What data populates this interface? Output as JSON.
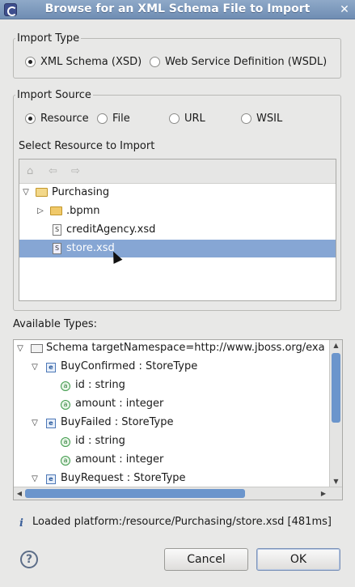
{
  "window": {
    "title": "Browse for an XML Schema File to Import",
    "close_glyph": "✕"
  },
  "import_type": {
    "legend": "Import Type",
    "options": [
      {
        "label": "XML Schema (XSD)",
        "selected": true
      },
      {
        "label": "Web Service Definition (WSDL)",
        "selected": false
      }
    ]
  },
  "import_source": {
    "legend": "Import Source",
    "options": [
      {
        "label": "Resource",
        "selected": true
      },
      {
        "label": "File",
        "selected": false
      },
      {
        "label": "URL",
        "selected": false
      },
      {
        "label": "WSIL",
        "selected": false
      }
    ]
  },
  "resource_tree": {
    "label": "Select Resource to Import",
    "items": [
      {
        "label": "Purchasing",
        "type": "folder",
        "expanded": true
      },
      {
        "label": ".bpmn",
        "type": "folder",
        "expanded": false
      },
      {
        "label": "creditAgency.xsd",
        "type": "file"
      },
      {
        "label": "store.xsd",
        "type": "file",
        "selected": true
      }
    ]
  },
  "types_tree": {
    "label": "Available Types:",
    "items": [
      {
        "label": "Schema targetNamespace=http://www.jboss.org/exa",
        "kind": "schema"
      },
      {
        "label": "BuyConfirmed : StoreType",
        "kind": "element"
      },
      {
        "label": "id : string",
        "kind": "attribute"
      },
      {
        "label": "amount : integer",
        "kind": "attribute"
      },
      {
        "label": "BuyFailed : StoreType",
        "kind": "element"
      },
      {
        "label": "id : string",
        "kind": "attribute"
      },
      {
        "label": "amount : integer",
        "kind": "attribute"
      },
      {
        "label": "BuyRequest : StoreType",
        "kind": "element"
      }
    ]
  },
  "status": {
    "icon": "i",
    "text": "Loaded platform:/resource/Purchasing/store.xsd [481ms]"
  },
  "buttons": {
    "help": "?",
    "cancel": "Cancel",
    "ok": "OK"
  }
}
